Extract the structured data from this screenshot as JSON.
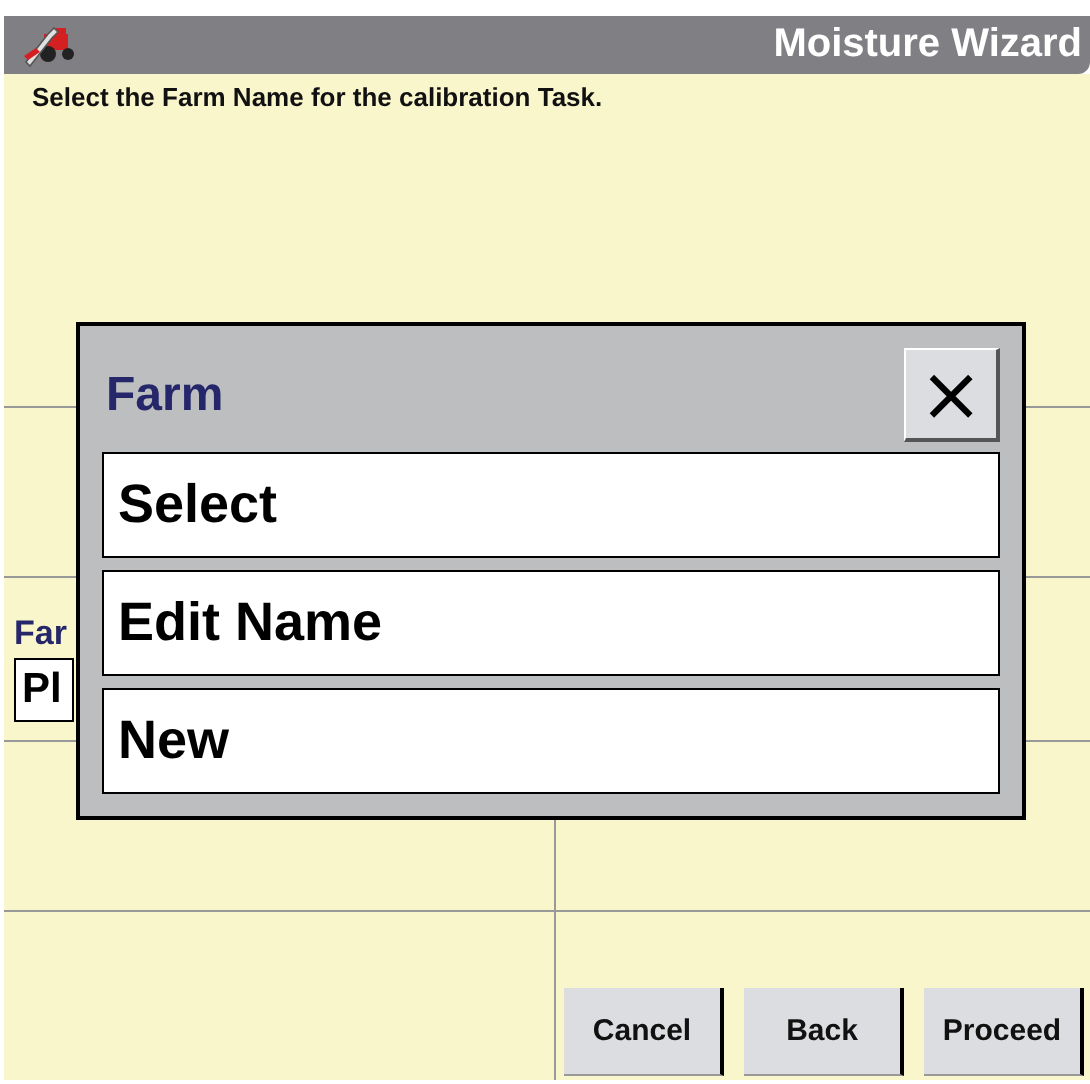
{
  "window": {
    "title": "Moisture Wizard"
  },
  "instruction": "Select the Farm Name for the calibration Task.",
  "farm_field": {
    "label": "Far",
    "value": "Pl"
  },
  "buttons": [
    {
      "label": "Cancel"
    },
    {
      "label": "Back"
    },
    {
      "label": "Proceed"
    }
  ],
  "dialog": {
    "title": "Farm",
    "close": "×",
    "options": [
      {
        "label": "Select"
      },
      {
        "label": "Edit Name"
      },
      {
        "label": "New"
      }
    ]
  }
}
